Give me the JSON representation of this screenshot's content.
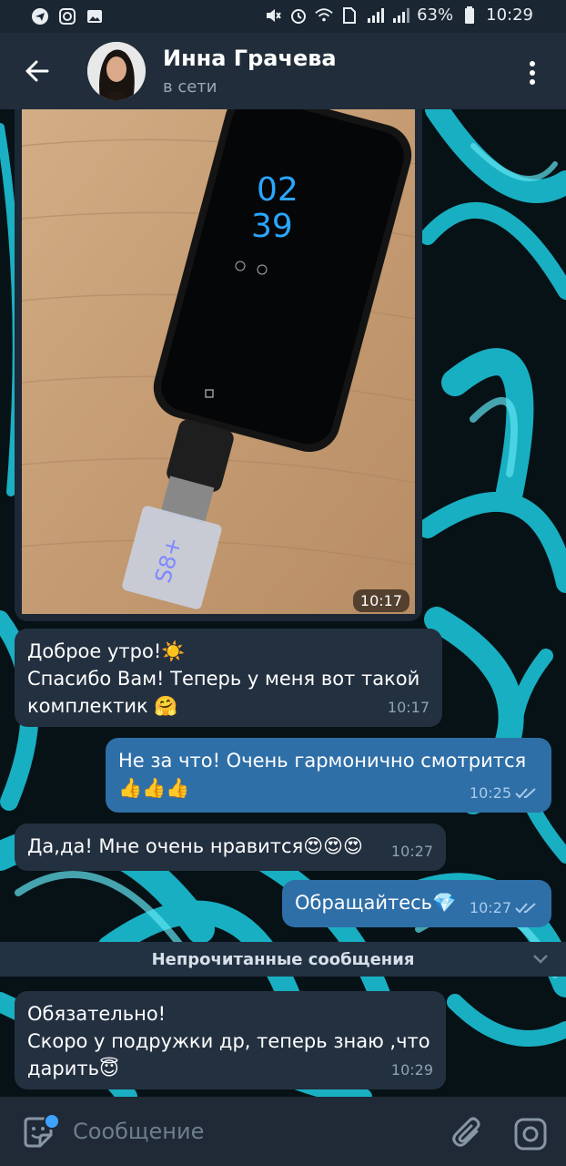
{
  "status_bar": {
    "battery": "63%",
    "time": "10:29"
  },
  "header": {
    "name": "Инна Грачева",
    "status": "в сети"
  },
  "messages": {
    "photo_time": "10:17",
    "m1": {
      "line1": "Доброе утро!☀️",
      "line2": "Спасибо Вам! Теперь у меня вот такой",
      "line3": "комплектик 🤗",
      "time": "10:17"
    },
    "m2": {
      "line1": "Не за что! Очень гармонично смотрится",
      "line2": "👍👍👍",
      "time": "10:25"
    },
    "m3": {
      "text": "Да,да! Мне очень нравится😍😍😍",
      "time": "10:27"
    },
    "m4": {
      "text": "Обращайтесь💎",
      "time": "10:27"
    },
    "m5": {
      "line1": "Обязательно!",
      "line2": "Скоро у подружки др, теперь знаю ,что",
      "line3": "дарить😇",
      "time": "10:29"
    }
  },
  "unread_label": "Непрочитанные сообщения",
  "photo_screen": {
    "clock_h": "02",
    "clock_m": "39",
    "usb_text": "S8+"
  },
  "composer": {
    "placeholder": "Сообщение"
  },
  "colors": {
    "header_bg": "#212d3b",
    "incoming_bubble": "#233040",
    "outgoing_bubble": "#2f6fa8",
    "wallpaper_accent": "#22c4d6"
  }
}
